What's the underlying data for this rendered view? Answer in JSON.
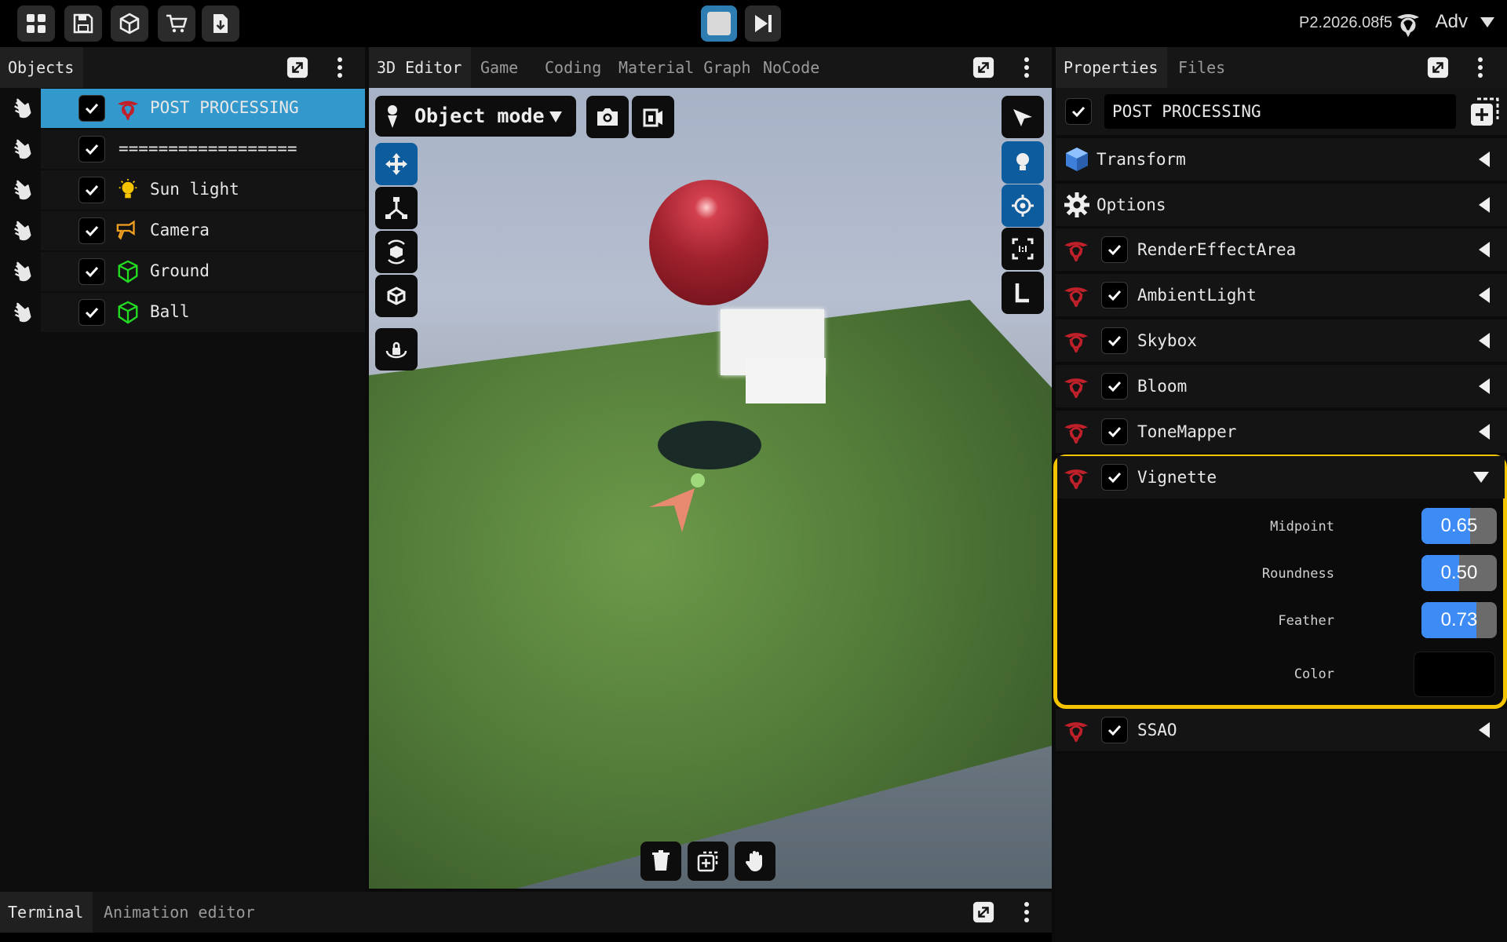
{
  "topbar": {
    "buttons": [
      "dashboard",
      "save",
      "package",
      "store",
      "export"
    ],
    "version": "P2.2026.08f5",
    "mode_label": "Adv"
  },
  "objects_panel": {
    "tab": "Objects",
    "items": [
      {
        "label": "POST PROCESSING",
        "icon": "post-processing-icon",
        "checked": true,
        "selected": true
      },
      {
        "label": "==================",
        "icon": "",
        "checked": true,
        "selected": false
      },
      {
        "label": "Sun light",
        "icon": "bulb-icon",
        "checked": true,
        "selected": false
      },
      {
        "label": "Camera",
        "icon": "camera-icon",
        "checked": true,
        "selected": false
      },
      {
        "label": "Ground",
        "icon": "mesh-icon",
        "checked": true,
        "selected": false
      },
      {
        "label": "Ball",
        "icon": "mesh-icon",
        "checked": true,
        "selected": false
      }
    ]
  },
  "editor": {
    "tabs": [
      "3D Editor",
      "Game",
      "Coding",
      "Material Graph",
      "NoCode"
    ],
    "active_tab": "3D Editor",
    "mode_select": "Object mode"
  },
  "properties": {
    "tabs": [
      "Properties",
      "Files"
    ],
    "active_tab": "Properties",
    "object_name": "POST PROCESSING",
    "sections": [
      {
        "label": "Transform"
      },
      {
        "label": "Options"
      },
      {
        "label": "RenderEffectArea"
      },
      {
        "label": "AmbientLight"
      },
      {
        "label": "Skybox"
      },
      {
        "label": "Bloom"
      },
      {
        "label": "ToneMapper"
      },
      {
        "label": "Vignette"
      },
      {
        "label": "SSAO"
      }
    ],
    "vignette": {
      "midpoint_label": "Midpoint",
      "midpoint_value": "0.65",
      "midpoint_fraction": 0.65,
      "roundness_label": "Roundness",
      "roundness_value": "0.50",
      "roundness_fraction": 0.5,
      "feather_label": "Feather",
      "feather_value": "0.73",
      "feather_fraction": 0.73,
      "color_label": "Color",
      "color_value": "#000000"
    }
  },
  "bottom": {
    "tabs": [
      "Terminal",
      "Animation editor"
    ],
    "active_tab": "Terminal"
  },
  "colors": {
    "accent_blue": "#3d8cf5",
    "selection": "#3399cc",
    "highlight_frame": "#f5c400",
    "brand_red": "#c0202a",
    "mesh_green": "#22dd22"
  }
}
